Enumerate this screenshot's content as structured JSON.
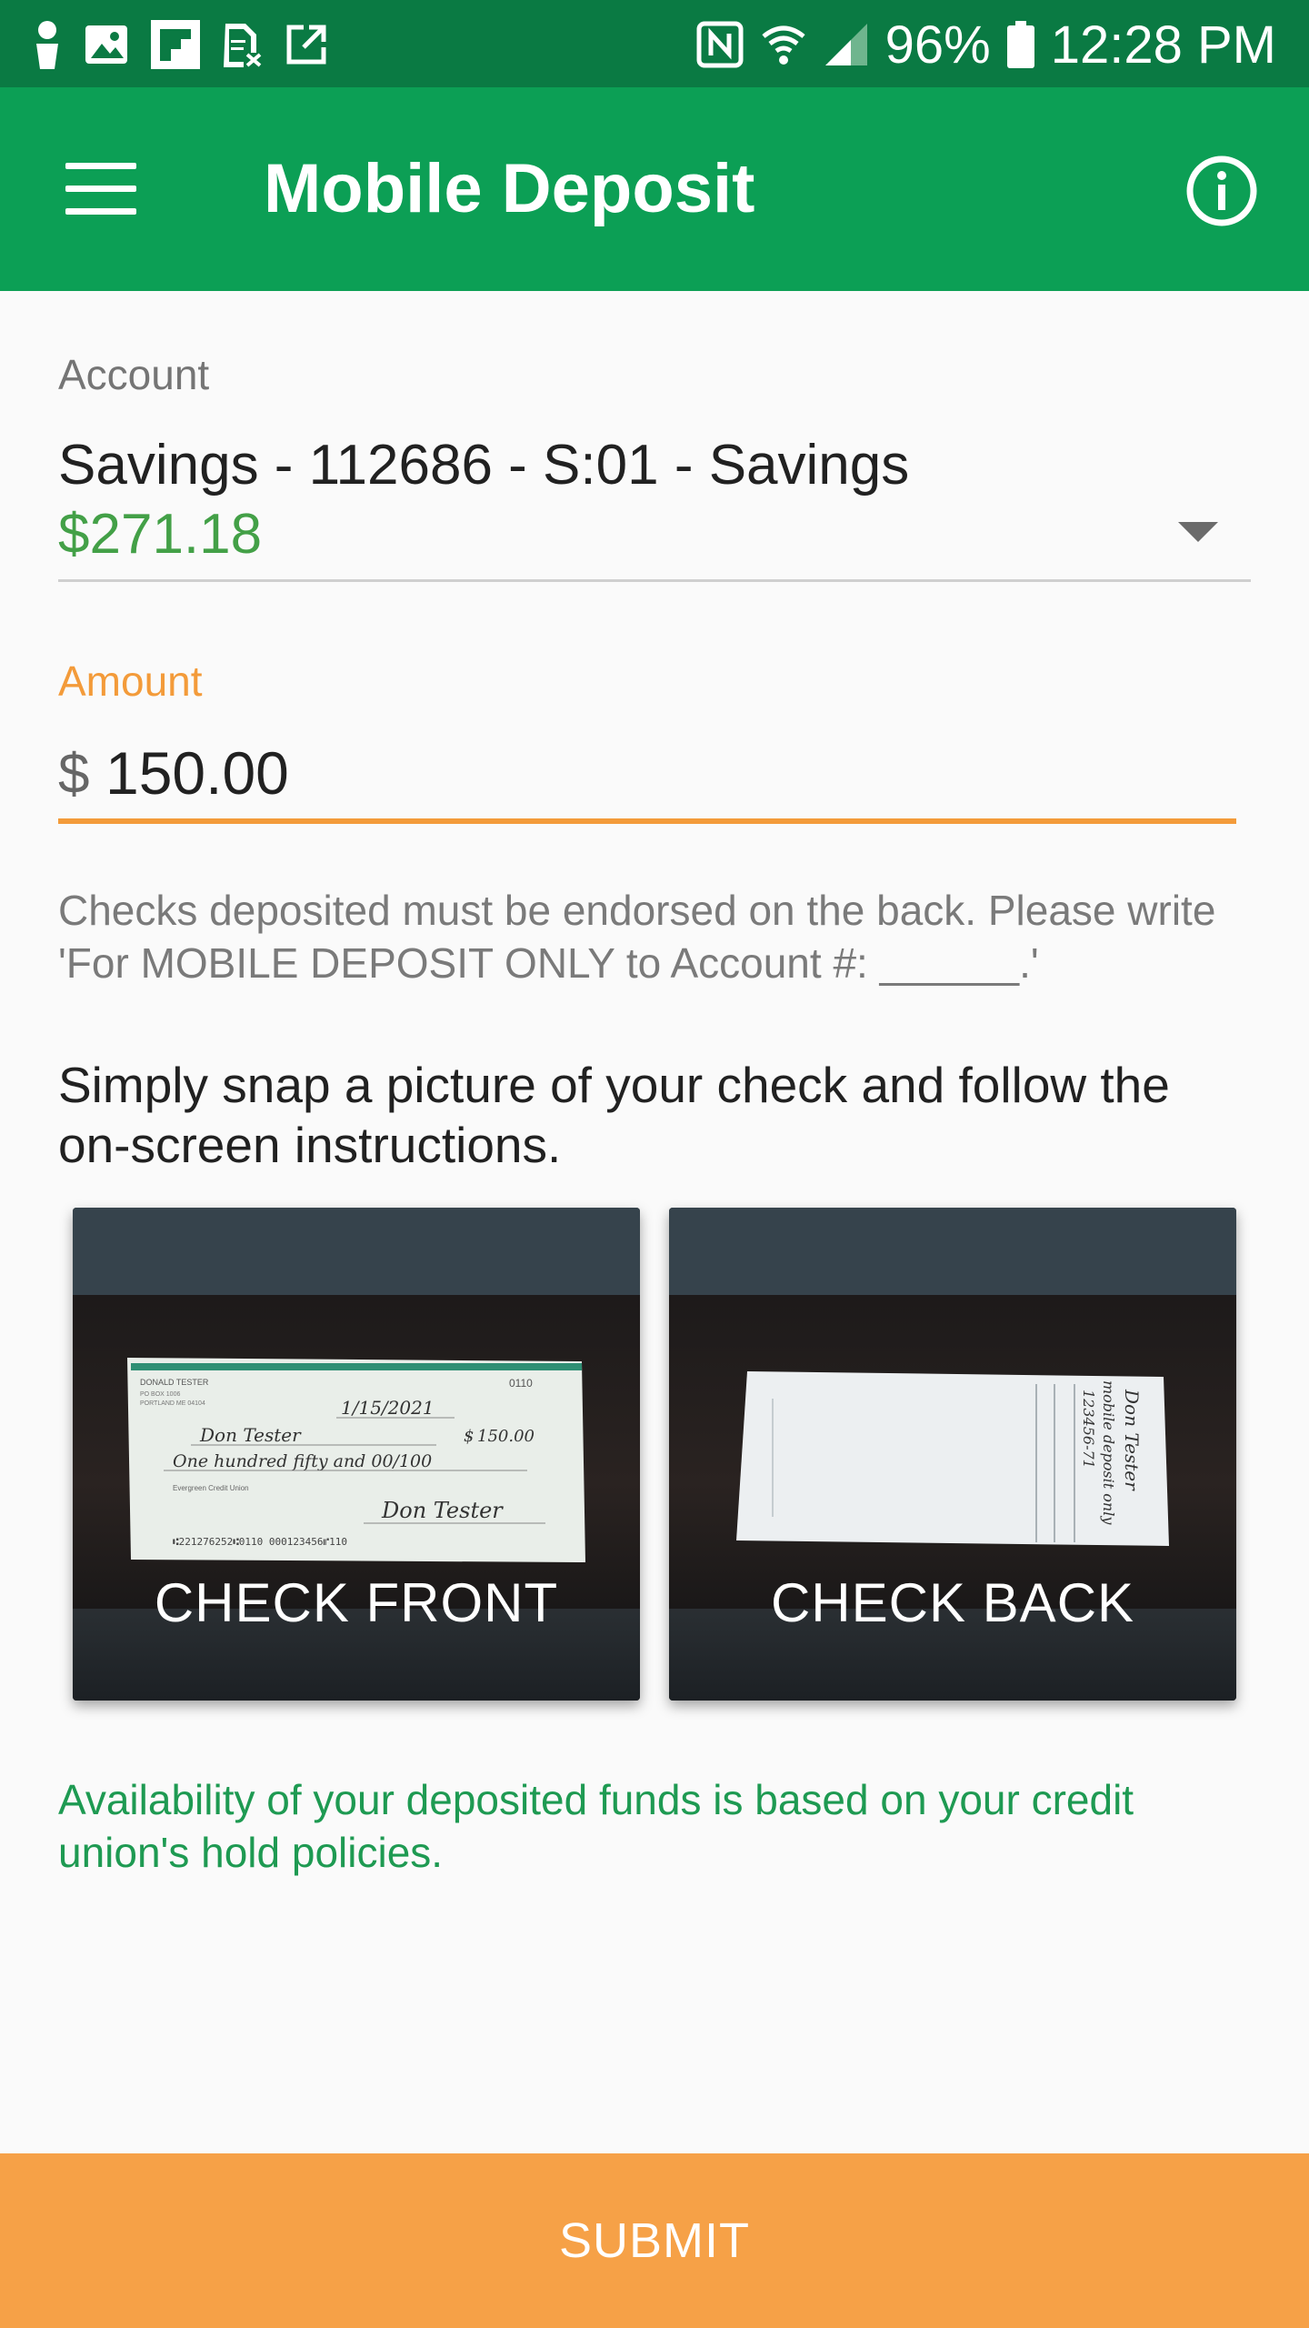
{
  "status_bar": {
    "battery": "96%",
    "time": "12:28 PM",
    "left_icons": [
      "person-icon",
      "image-icon",
      "flipboard-icon",
      "sim-icon",
      "external-link-icon"
    ],
    "right_icons": [
      "nfc-icon",
      "wifi-icon",
      "signal-icon",
      "battery-icon"
    ]
  },
  "app_bar": {
    "title": "Mobile Deposit",
    "colors": {
      "status": "#0a7a43",
      "bar": "#0c9f55"
    }
  },
  "form": {
    "account_label": "Account",
    "account_name": "Savings - 112686 - S:01 - Savings",
    "account_balance": "$271.18",
    "amount_label": "Amount",
    "currency_symbol": "$",
    "amount_value": "150.00"
  },
  "endorse_note": "Checks deposited must be endorsed on the back.  Please write 'For MOBILE DEPOSIT ONLY to Account #: ______.'",
  "instructions": "Simply snap a picture of your check and follow the on-screen instructions.",
  "check_front": {
    "label": "CHECK FRONT",
    "payer_name": "DONALD TESTER",
    "date": "1/15/2021",
    "payee": "Don Tester",
    "amount": "150.00",
    "written_amount": "One hundred fifty and 00/100",
    "bank": "Evergreen Credit Union",
    "signature": "Don Tester",
    "check_number": "0110"
  },
  "check_back": {
    "label": "CHECK BACK",
    "endorse_line_1": "Don Tester",
    "endorse_line_2": "mobile deposit only",
    "endorse_line_3": "123456-71"
  },
  "availability": "Availability of your deposited funds is based on your credit union's hold policies.",
  "submit_label": "SUBMIT",
  "accent_colors": {
    "orange": "#f6a147",
    "green_text": "#1e9a52",
    "balance_green": "#43a047"
  }
}
